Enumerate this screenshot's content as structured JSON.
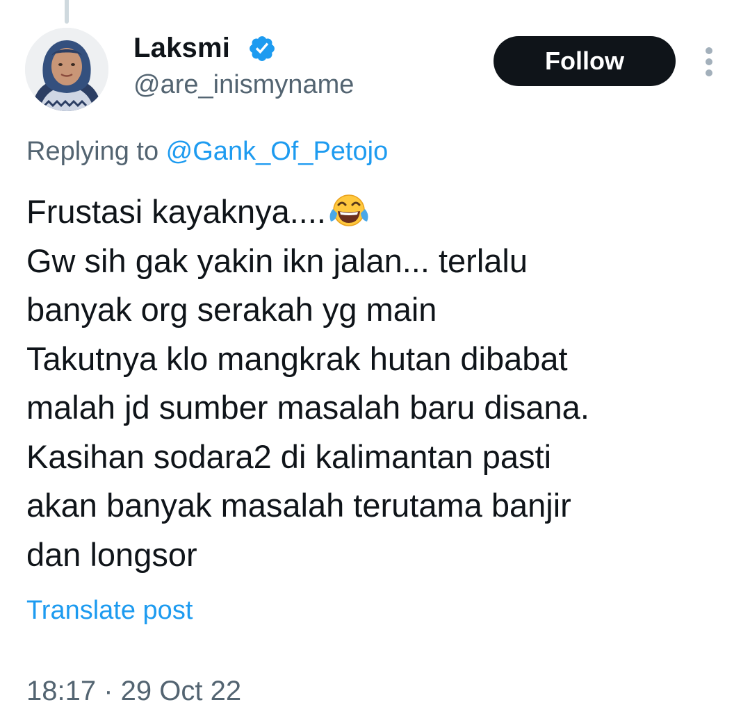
{
  "author": {
    "display_name": "Laksmi",
    "handle": "@are_inismyname",
    "verified": true,
    "avatar": "profile-photo-woman-hijab"
  },
  "actions": {
    "follow_label": "Follow",
    "more_icon": "more-vertical-icon"
  },
  "reply": {
    "prefix": "Replying to ",
    "target": "@Gank_Of_Petojo"
  },
  "tweet": {
    "lines": [
      "Frustasi kayaknya....",
      "Gw sih gak yakin ikn jalan... terlalu",
      "banyak org serakah yg main",
      "Takutnya klo mangkrak hutan dibabat",
      "malah jd sumber masalah baru disana.",
      "Kasihan sodara2 di kalimantan pasti",
      "akan banyak masalah terutama banjir",
      "dan longsor"
    ],
    "emoji": "face-with-tears-of-joy"
  },
  "translate_label": "Translate post",
  "timestamp": "18:17 · 29 Oct 22",
  "colors": {
    "text": "#0f1419",
    "secondary": "#536471",
    "link": "#1d9bf0",
    "button_bg": "#0f1419",
    "badge": "#1d9bf0"
  }
}
